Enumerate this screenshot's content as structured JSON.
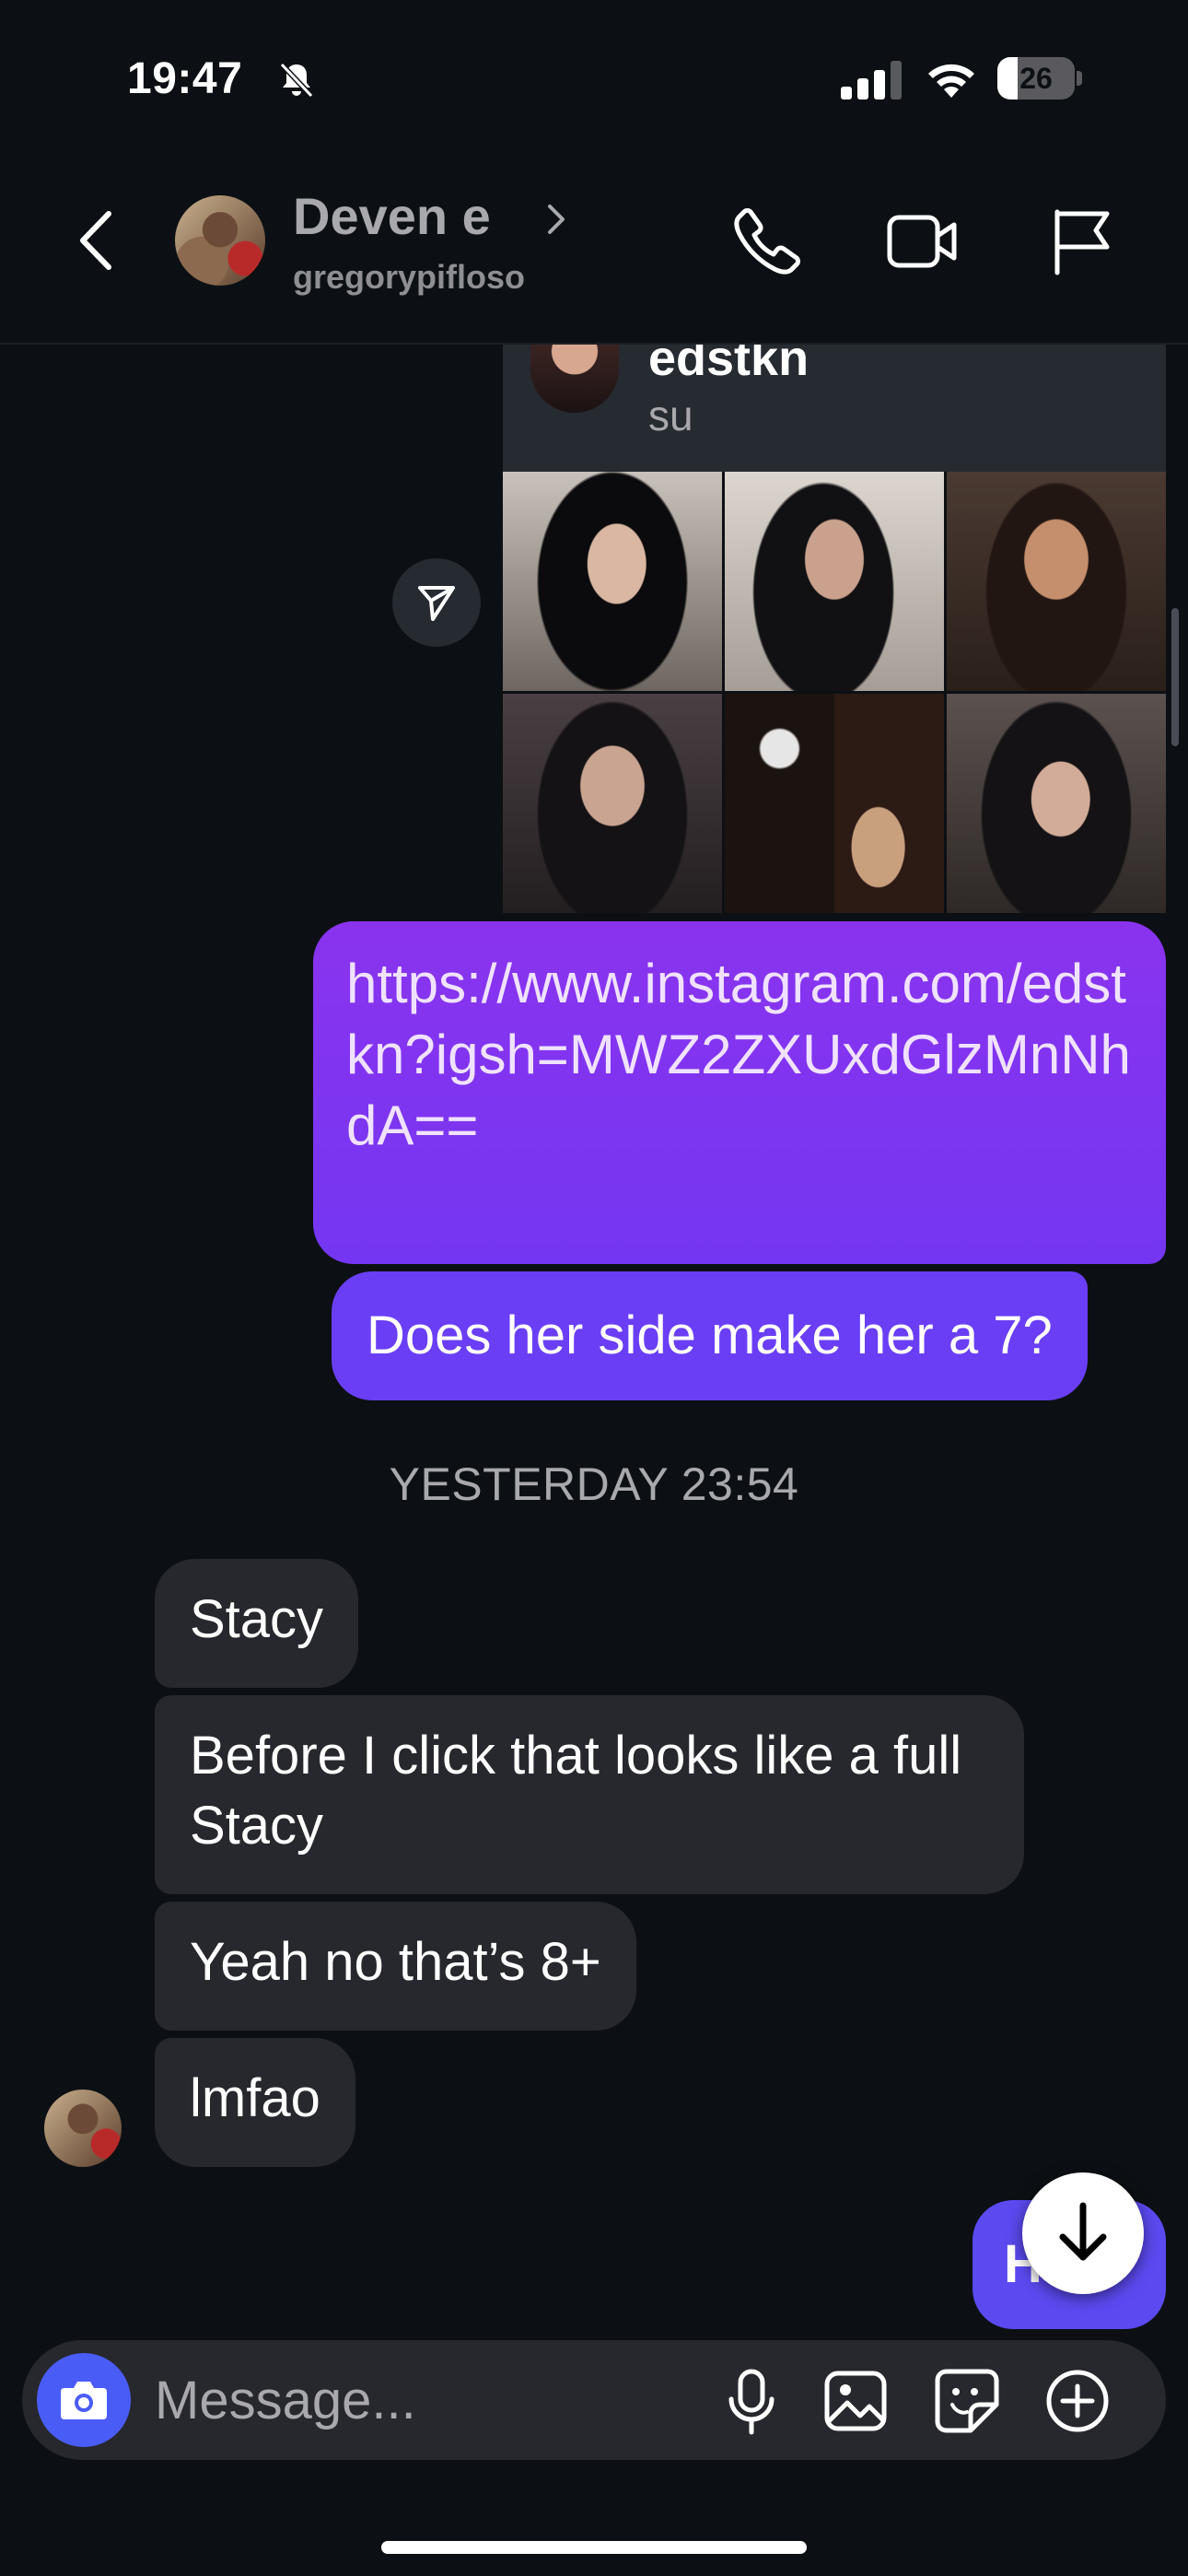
{
  "status_bar": {
    "time": "19:47",
    "battery_level": "26",
    "battery_fraction": 0.26
  },
  "header": {
    "contact_name": "Deven e",
    "contact_username": "gregorypifloso"
  },
  "shared_profile": {
    "username": "edstkn",
    "name": "su"
  },
  "messages": {
    "outgoing_link": "https://www.instagram.com/edstkn?igsh=MWZ2ZXUxdGlzMnNhdA==",
    "outgoing_question": "Does her side make her a 7?",
    "timestamp": "YESTERDAY 23:54",
    "incoming": [
      "Stacy",
      "Before I click that looks like a full Stacy",
      "Yeah no that’s 8+",
      "lmfao"
    ],
    "partial_outgoing": "Ha"
  },
  "composer": {
    "placeholder": "Message..."
  },
  "colors": {
    "background": "#0c1014",
    "outgoing_bubble": "#7b3cf0",
    "incoming_bubble": "#26282d",
    "camera_button": "#4a5cf6"
  }
}
